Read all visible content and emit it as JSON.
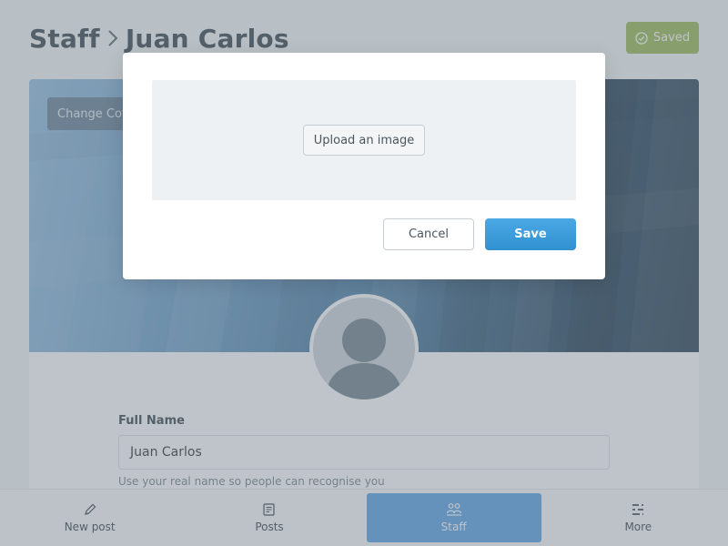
{
  "header": {
    "breadcrumb": [
      "Staff",
      "Juan Carlos"
    ],
    "saved_label": "Saved",
    "saved_color": "#9fbb58"
  },
  "cover": {
    "change_cover_label": "Change Cover"
  },
  "form": {
    "full_name_label": "Full Name",
    "full_name_value": "Juan Carlos",
    "full_name_help": "Use your real name so people can recognise you"
  },
  "bottom_nav": {
    "items": [
      {
        "label": "New post",
        "icon": "pencil-icon",
        "active": false
      },
      {
        "label": "Posts",
        "icon": "posts-icon",
        "active": false
      },
      {
        "label": "Staff",
        "icon": "staff-icon",
        "active": true
      },
      {
        "label": "More",
        "icon": "more-icon",
        "active": false
      }
    ],
    "active_color": "#5ba4e5"
  },
  "modal": {
    "upload_label": "Upload an image",
    "cancel_label": "Cancel",
    "save_label": "Save",
    "save_color": "#3a9ad9"
  }
}
